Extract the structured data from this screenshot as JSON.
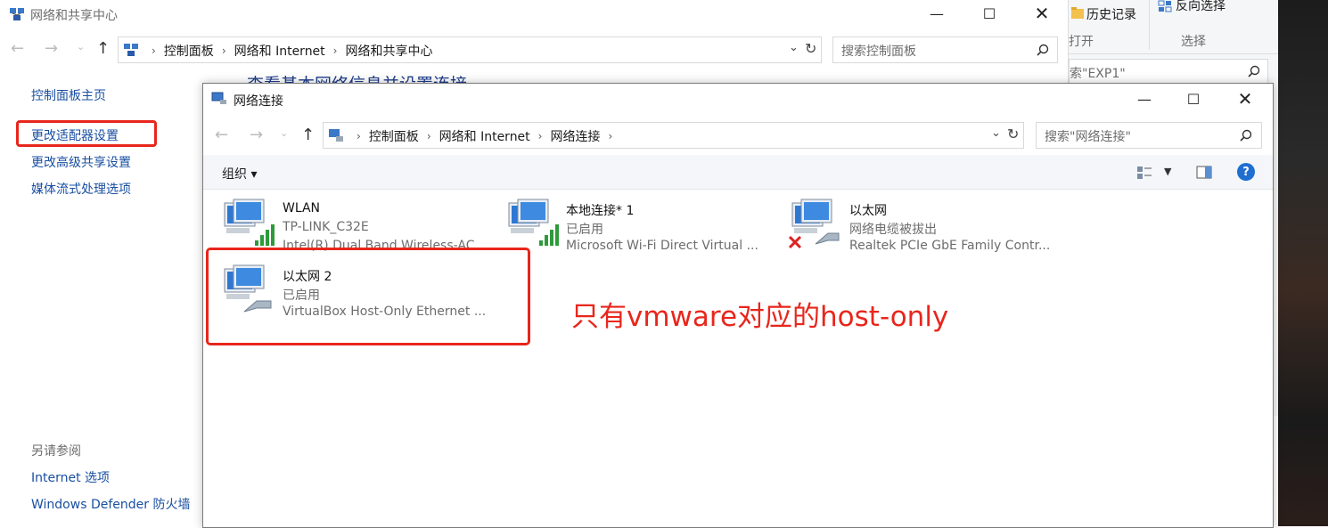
{
  "bg_window": {
    "title": "网络和共享中心",
    "breadcrumb": [
      "控制面板",
      "网络和 Internet",
      "网络和共享中心"
    ],
    "search_placeholder": "搜索控制面板",
    "heading_partial": "查看基本网络信息并设置连接",
    "sidebar": {
      "items": [
        "控制面板主页",
        "更改适配器设置",
        "更改高级共享设置",
        "媒体流式处理选项"
      ],
      "see_also_label": "另请参阅",
      "see_also": [
        "Internet 选项",
        "Windows Defender 防火墙"
      ]
    }
  },
  "right_window": {
    "history": "历史记录",
    "invert": "反向选择",
    "open": "打开",
    "select": "选择",
    "search": "索\"EXP1\""
  },
  "fg_window": {
    "title": "网络连接",
    "breadcrumb": [
      "控制面板",
      "网络和 Internet",
      "网络连接"
    ],
    "search_placeholder": "搜索\"网络连接\"",
    "organize": "组织 ▾",
    "help": "?",
    "adapters": [
      {
        "name": "WLAN",
        "status": "TP-LINK_C32E",
        "device": "Intel(R) Dual Band Wireless-AC..."
      },
      {
        "name": "本地连接* 1",
        "status": "已启用",
        "device": "Microsoft Wi-Fi Direct Virtual ..."
      },
      {
        "name": "以太网",
        "status": "网络电缆被拔出",
        "device": "Realtek PCIe GbE Family Contr..."
      },
      {
        "name": "以太网 2",
        "status": "已启用",
        "device": "VirtualBox Host-Only Ethernet ..."
      }
    ]
  },
  "annotation": "只有vmware对应的host-only",
  "colors": {
    "highlight_red": "#e8261c",
    "link_blue": "#1a4fa0",
    "annotation_red": "#e8261c"
  }
}
